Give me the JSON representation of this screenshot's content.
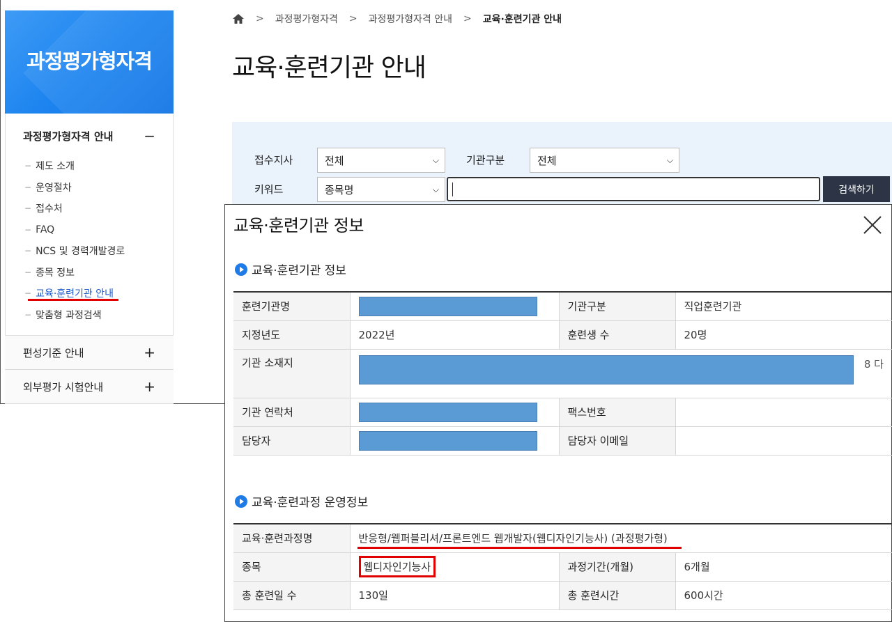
{
  "sidebar": {
    "banner_title": "과정평가형자격",
    "group1": {
      "label": "과정평가형자격 안내",
      "sign": "−"
    },
    "items": [
      {
        "label": "제도 소개"
      },
      {
        "label": "운영절차"
      },
      {
        "label": "접수처"
      },
      {
        "label": "FAQ"
      },
      {
        "label": "NCS 및 경력개발경로"
      },
      {
        "label": "종목 정보"
      },
      {
        "label": "교육·훈련기관 안내"
      },
      {
        "label": "맞춤형 과정검색"
      }
    ],
    "group2": {
      "label": "편성기준 안내",
      "sign": "+"
    },
    "group3": {
      "label": "외부평가 시험안내",
      "sign": "+"
    }
  },
  "breadcrumb": {
    "items": [
      "과정평가형자격",
      "과정평가형자격 안내"
    ],
    "current": "교육·훈련기관 안내",
    "separator": ">"
  },
  "page_title": "교육·훈련기관 안내",
  "search": {
    "branch_label": "접수지사",
    "branch_value": "전체",
    "type_label": "기관구분",
    "type_value": "전체",
    "keyword_label": "키워드",
    "keyword_field_value": "종목명",
    "keyword_input_value": "",
    "search_button": "검색하기"
  },
  "modal": {
    "title": "교육·훈련기관 정보",
    "section1_title": "교육·훈련기관 정보",
    "section2_title": "교육·훈련과정 운영정보",
    "org": {
      "name_label": "훈련기관명",
      "type_label": "기관구분",
      "type_value": "직업훈련기관",
      "year_label": "지정년도",
      "year_value": "2022년",
      "trainees_label": "훈련생 수",
      "trainees_value": "20명",
      "address_label": "기관 소재지",
      "address_tail": "8 다",
      "contact_label": "기관 연락처",
      "fax_label": "팩스번호",
      "fax_value": "",
      "manager_label": "담당자",
      "email_label": "담당자 이메일",
      "email_value": ""
    },
    "course": {
      "name_label": "교육·훈련과정명",
      "name_value": "반응형/웹퍼블리셔/프론트엔드 웹개발자(웹디자인기능사) (과정평가형)",
      "jongmok_label": "종목",
      "jongmok_value": "웹디자인기능사",
      "period_label": "과정기간(개월)",
      "period_value": "6개월",
      "days_label": "총 훈련일 수",
      "days_value": "130일",
      "hours_label": "총 훈련시간",
      "hours_value": "600시간"
    }
  },
  "colors": {
    "banner": "#1f86f0",
    "accent_red": "#e00000",
    "search_bg": "#eaf3fc",
    "button_dark": "#2d3446",
    "redaction": "#5b9bd5",
    "bullet": "#1f7be8"
  }
}
